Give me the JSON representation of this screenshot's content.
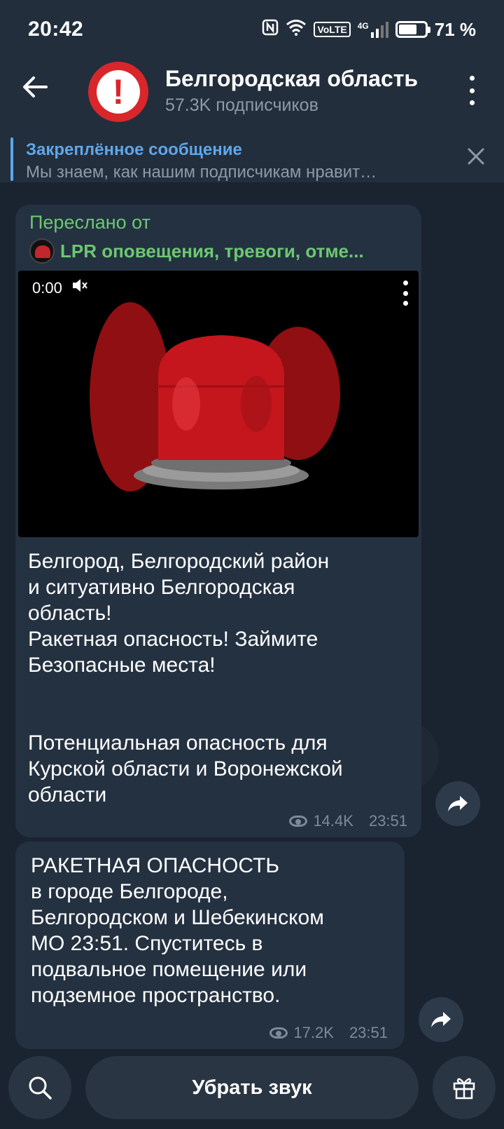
{
  "status_bar": {
    "time": "20:42",
    "nfc_icon": "nfc-icon",
    "wifi_icon": "wifi-icon",
    "volte": "VoLTE",
    "network": "4G",
    "signal_icon": "signal-icon",
    "battery_level": 0.71,
    "battery_text": "71 %"
  },
  "header": {
    "back_icon": "arrow-left-icon",
    "title": "Белгородская область",
    "subtitle": "57.3K подписчиков",
    "menu_icon": "vertical-dots-icon"
  },
  "pinned": {
    "title": "Закреплённое сообщение",
    "text": "Мы знаем, как нашим подписчикам нравит…",
    "close_icon": "close-icon"
  },
  "messages": [
    {
      "forwarded_label": "Переслано от",
      "forwarded_from": "LPR оповещения, тревоги, отме...",
      "video": {
        "time": "0:00",
        "mute_icon": "speaker-muted-icon"
      },
      "text": "Белгород, Белгородский район\nи ситуативно Белгородская\nобласть!\nРакетная опасность! Займите\nБезопасные места!\n\n\nПотенциальная опасность для\nКурской области и Воронежской\nобласти",
      "views": "14.4K",
      "time": "23:51"
    },
    {
      "text": "РАКЕТНАЯ ОПАСНОСТЬ\nв городе Белгороде,\nБелгородском и Шебекинском\nМО 23:51. Спуститесь в\nподвальное помещение или\nподземное пространство.",
      "views": "17.2K",
      "time": "23:51"
    }
  ],
  "bottom": {
    "search_icon": "search-icon",
    "mute_label": "Убрать звук",
    "gift_icon": "gift-icon"
  },
  "colors": {
    "background": "#1a2330",
    "header": "#232e3c",
    "bubble": "#243141",
    "accent_blue": "#5ea7ea",
    "accent_green": "#6cc870",
    "alert_red": "#d9262b"
  }
}
